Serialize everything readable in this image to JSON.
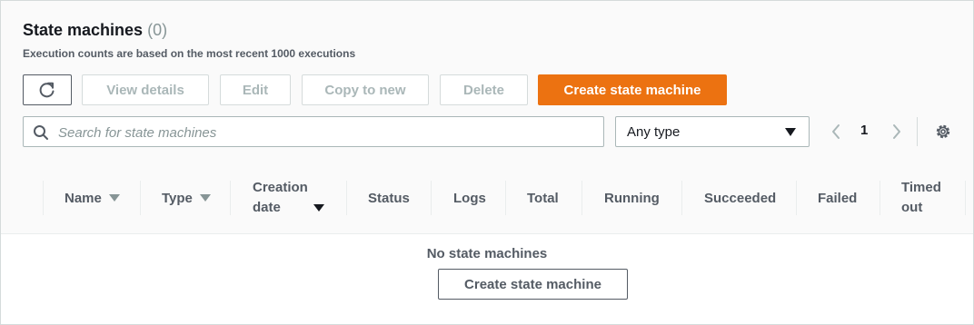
{
  "header": {
    "title": "State machines",
    "count": "(0)",
    "subtitle": "Execution counts are based on the most recent 1000 executions"
  },
  "toolbar": {
    "view_details": "View details",
    "edit": "Edit",
    "copy_to_new": "Copy to new",
    "delete": "Delete",
    "create": "Create state machine"
  },
  "search": {
    "placeholder": "Search for state machines",
    "value": ""
  },
  "filter": {
    "selected": "Any type"
  },
  "pagination": {
    "page": "1"
  },
  "columns": {
    "name": "Name",
    "type": "Type",
    "creation_date_1": "Creation",
    "creation_date_2": "date",
    "status": "Status",
    "logs": "Logs",
    "total": "Total",
    "running": "Running",
    "succeeded": "Succeeded",
    "failed": "Failed",
    "timed_out_1": "Timed",
    "timed_out_2": "out"
  },
  "empty": {
    "message": "No state machines",
    "button": "Create state machine"
  },
  "colors": {
    "primary": "#ec7211",
    "border": "#d5dbdb",
    "text_muted": "#879596"
  }
}
